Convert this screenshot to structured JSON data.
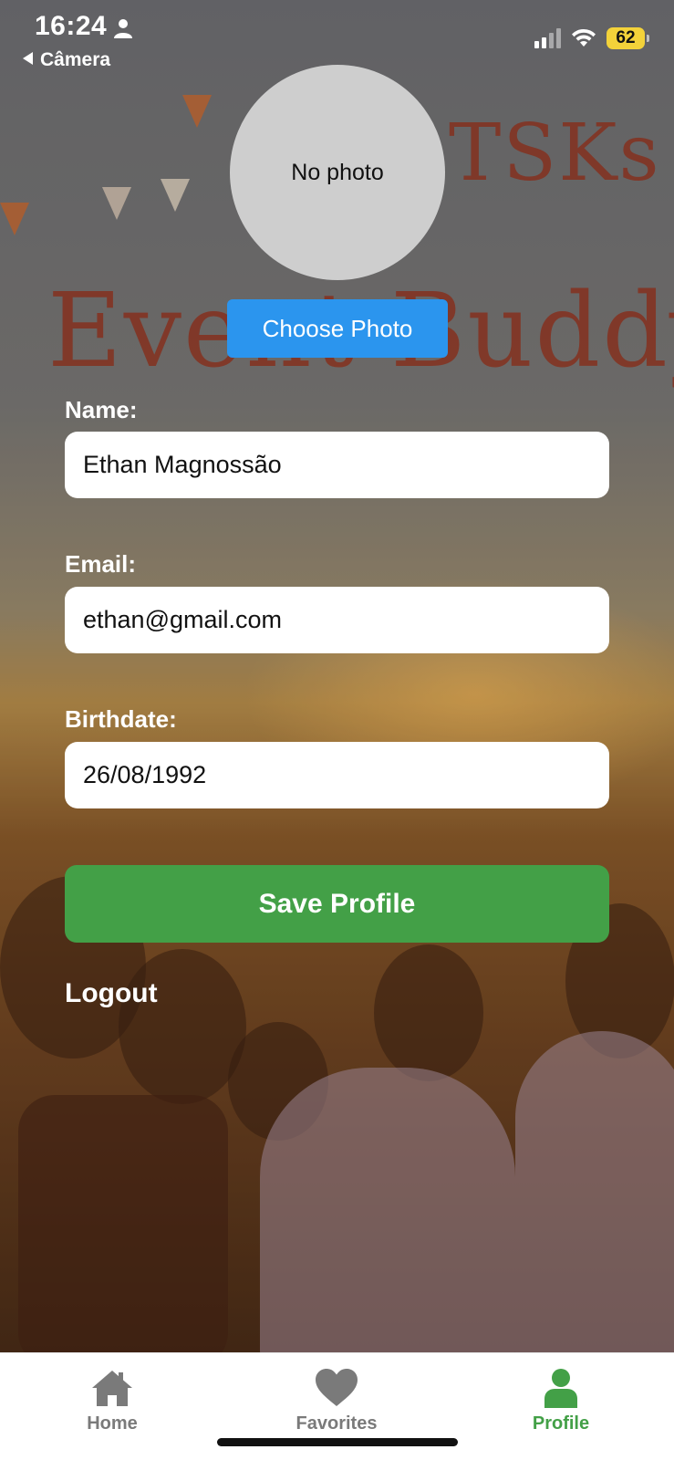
{
  "status_bar": {
    "time": "16:24",
    "back_label": "Câmera",
    "battery": "62"
  },
  "background": {
    "text_top": "TSKs",
    "text_main": "Event Buddy"
  },
  "profile": {
    "photo_placeholder": "No photo",
    "choose_photo_label": "Choose Photo",
    "name_label": "Name:",
    "name_value": "Ethan Magnossão",
    "email_label": "Email:",
    "email_value": "ethan@gmail.com",
    "birthdate_label": "Birthdate:",
    "birthdate_value": "26/08/1992",
    "save_label": "Save Profile",
    "logout_label": "Logout"
  },
  "tabs": [
    {
      "label": "Home",
      "icon": "home-icon",
      "active": false
    },
    {
      "label": "Favorites",
      "icon": "heart-icon",
      "active": false
    },
    {
      "label": "Profile",
      "icon": "person-icon",
      "active": true
    }
  ],
  "colors": {
    "accent_blue": "#2b95ee",
    "save_green": "#43a047",
    "tab_inactive": "#7a7a7a",
    "battery_yellow": "#f3d23a"
  }
}
